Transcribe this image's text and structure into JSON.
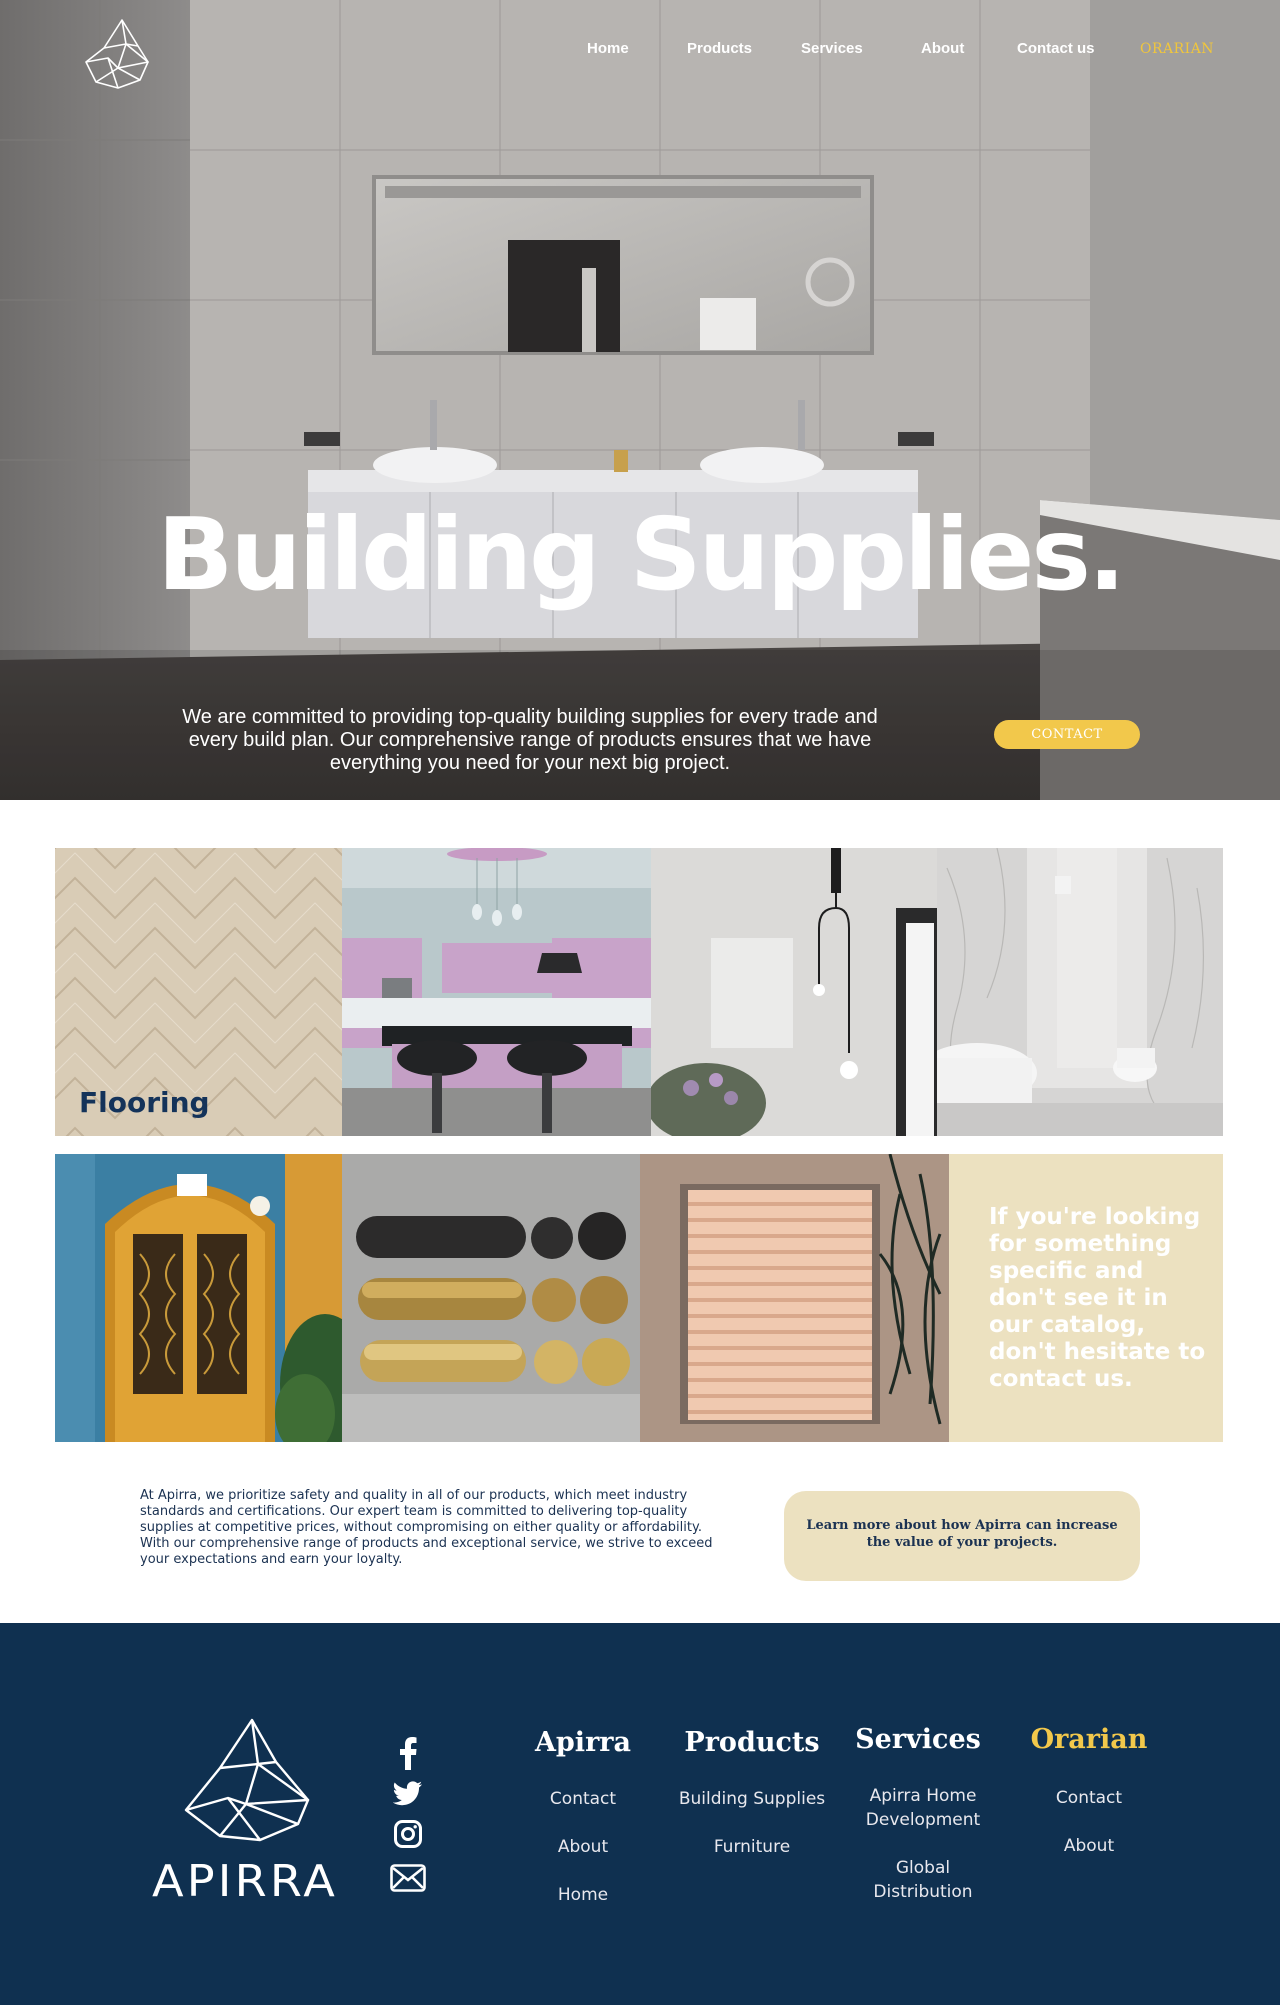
{
  "nav": {
    "items": [
      "Home",
      "Products",
      "Services",
      "About",
      "Contact us"
    ],
    "brand": "ORARIAN"
  },
  "hero": {
    "title": "Building Supplies.",
    "description_lines": [
      "We are committed to providing top-quality building supplies for every trade and",
      "every build plan. Our comprehensive range of products ensures that we have",
      "everything you need for your next big project."
    ],
    "contact_button": "CONTACT"
  },
  "gallery": {
    "flooring_label": "Flooring",
    "cta_lines": [
      "If you're looking",
      "for something",
      "specific and",
      "don't see it in",
      "our catalog,",
      "don't hesitate to",
      "contact us."
    ]
  },
  "info": {
    "lines": [
      "At Apirra, we prioritize safety and quality in all of our products, which meet industry",
      "standards and certifications. Our expert team is committed to delivering top-quality",
      "supplies at competitive prices, without compromising on either quality or affordability.",
      "With our comprehensive range of products and exceptional service, we strive to exceed",
      "your expectations and earn your loyalty."
    ],
    "learn_more_lines": [
      "Learn more about how Apirra can increase",
      "the value of your projects."
    ]
  },
  "footer": {
    "logo_text": "APIRRA",
    "columns": [
      {
        "title": "Apirra",
        "links": [
          "Contact",
          "About",
          "Home"
        ]
      },
      {
        "title": "Products",
        "links": [
          "Building Supplies",
          "Furniture"
        ]
      },
      {
        "title": "Services",
        "links": [
          "Apirra Home Development",
          "Global Distribution"
        ],
        "link_lines": [
          [
            "Apirra Home",
            "Development"
          ],
          [
            "Global",
            "Distribution"
          ]
        ]
      },
      {
        "title": "Orarian",
        "links": [
          "Contact",
          "About"
        ]
      }
    ],
    "social": [
      "facebook-icon",
      "twitter-icon",
      "instagram-icon",
      "mail-icon"
    ]
  },
  "colors": {
    "accent_gold": "#f2c84b",
    "navy": "#0f3050",
    "cream": "#ece1c0",
    "text_navy": "#1b3252"
  }
}
